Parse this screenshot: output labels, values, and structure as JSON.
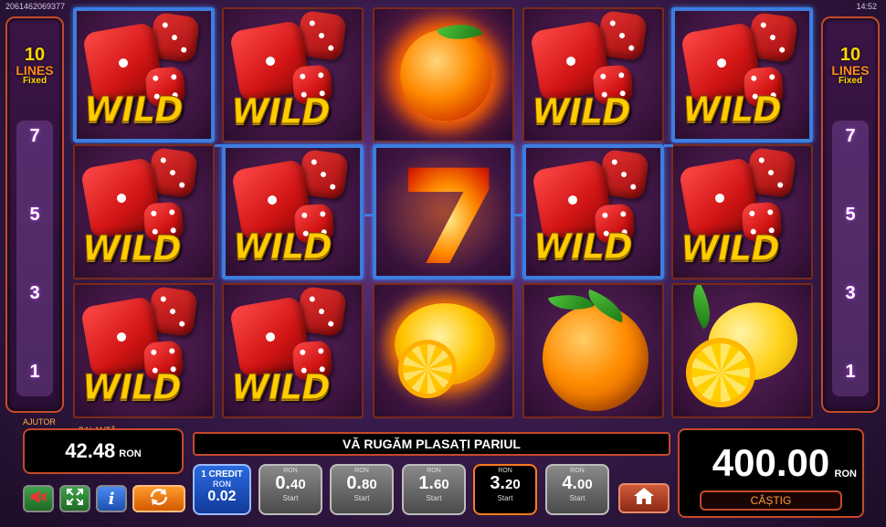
{
  "header": {
    "round_id": "2061462069377",
    "clock": "14:52"
  },
  "lines_panel": {
    "left": {
      "count": "10",
      "word": "LINES",
      "mode": "Fixed"
    },
    "right": {
      "count": "10",
      "word": "LINES",
      "mode": "Fixed"
    },
    "markers": [
      "7",
      "5",
      "3",
      "1"
    ]
  },
  "reels": {
    "columns": [
      [
        "wild",
        "wild",
        "wild"
      ],
      [
        "wild",
        "wild",
        "wild"
      ],
      [
        "fire-orange",
        "fire-seven",
        "fire-lemon"
      ],
      [
        "wild",
        "wild",
        "orange"
      ],
      [
        "wild",
        "wild",
        "lemon"
      ]
    ],
    "symbol_text": {
      "wild": "WILD"
    },
    "winning_line": [
      [
        0,
        0
      ],
      [
        1,
        1
      ],
      [
        2,
        1
      ],
      [
        3,
        1
      ],
      [
        4,
        0
      ]
    ]
  },
  "bottom": {
    "help_label": "AJUTOR",
    "balance_label": "BALANȚĂ",
    "balance_value": "42.48",
    "balance_currency": "RON",
    "message": "VĂ RUGĂM PLASAȚI PARIUL",
    "win_value": "400.00",
    "win_currency": "RON",
    "win_label": "CÂȘTIG",
    "credit": {
      "top": "1 CREDIT",
      "currency": "RON",
      "value": "0.02"
    },
    "bets": [
      {
        "currency": "RON",
        "int": "0.",
        "dec": "40",
        "start": "Start",
        "active": false
      },
      {
        "currency": "RON",
        "int": "0.",
        "dec": "80",
        "start": "Start",
        "active": false
      },
      {
        "currency": "RON",
        "int": "1.",
        "dec": "60",
        "start": "Start",
        "active": false
      },
      {
        "currency": "RON",
        "int": "3.",
        "dec": "20",
        "start": "Start",
        "active": true
      },
      {
        "currency": "RON",
        "int": "4.",
        "dec": "00",
        "start": "Start",
        "active": false
      }
    ]
  },
  "icons": {
    "sound": "speaker-muted-icon",
    "fullscreen": "fullscreen-icon",
    "info": "info-icon",
    "autoplay": "autoplay-icon",
    "home": "home-icon"
  },
  "colors": {
    "accent": "#c44a2a",
    "win_frame": "#3d7de0",
    "gold": "#ffcc00"
  }
}
